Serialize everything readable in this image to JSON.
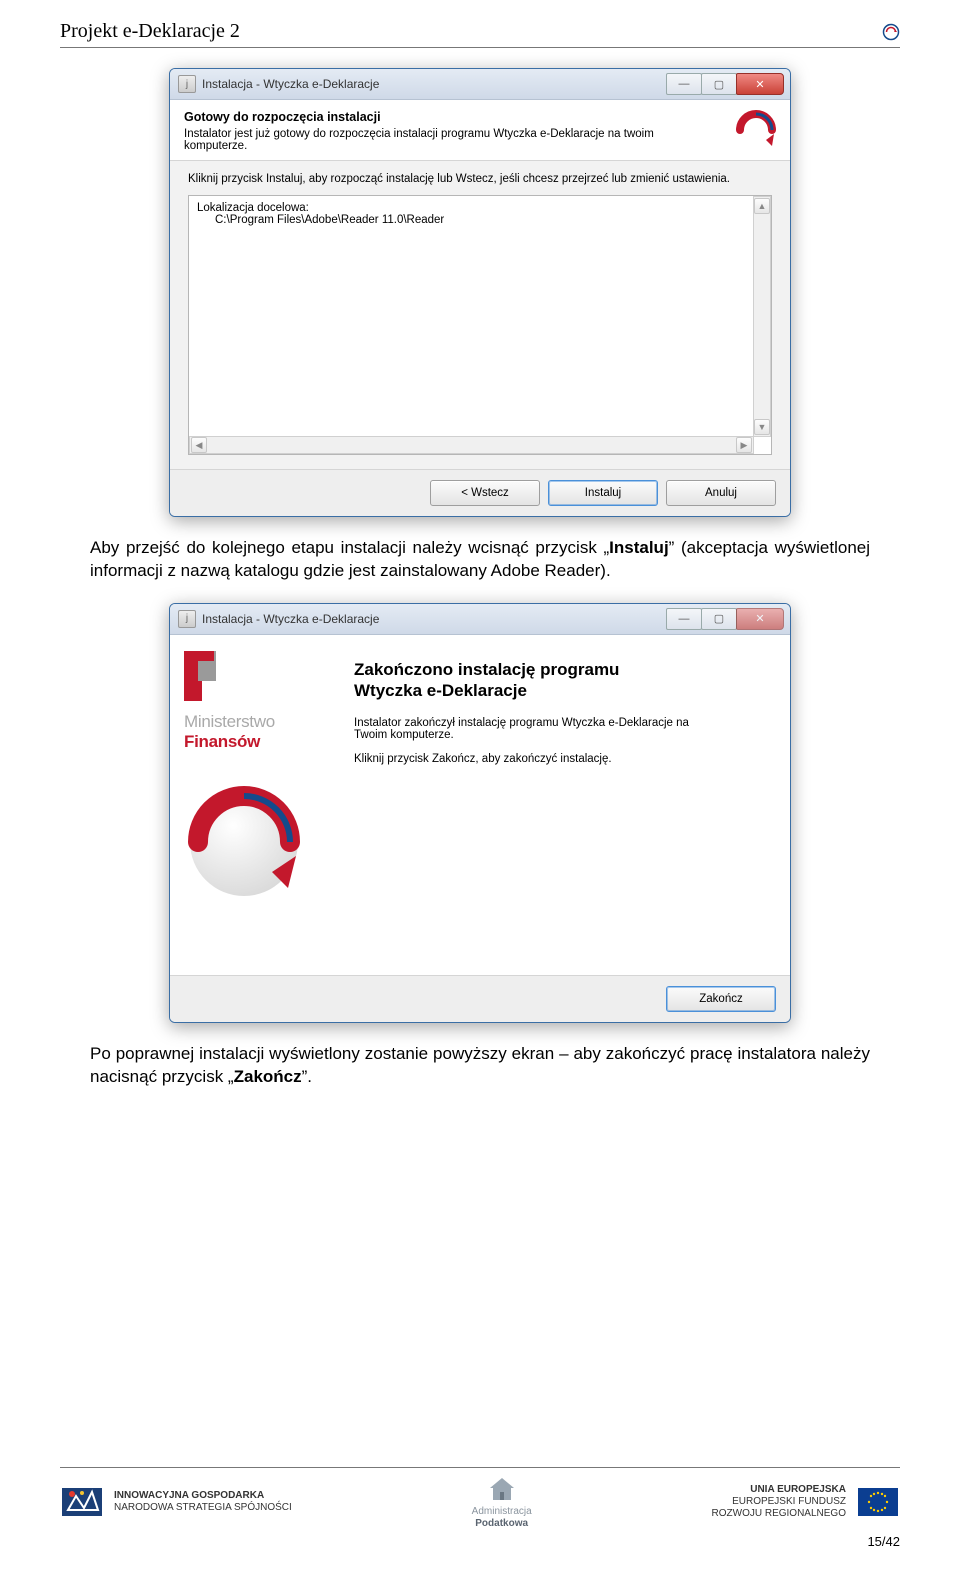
{
  "doc": {
    "header_title": "Projekt e-Deklaracje 2",
    "page_number": "15/42"
  },
  "para1": {
    "prefix": "Aby przejść do kolejnego etapu instalacji należy wcisnąć przycisk „",
    "bold": "Instaluj",
    "suffix": "” (akceptacja wyświetlonej informacji z nazwą katalogu gdzie jest zainstalowany Adobe Reader)."
  },
  "para2": {
    "prefix": "Po poprawnej instalacji wyświetlony zostanie powyższy ekran – aby zakończyć pracę instalatora należy nacisnąć przycisk „",
    "bold": "Zakończ",
    "suffix": "”."
  },
  "win1": {
    "title": "Instalacja - Wtyczka e-Deklaracje",
    "heading": "Gotowy do rozpoczęcia instalacji",
    "subheading": "Instalator jest już gotowy do rozpoczęcia instalacji programu Wtyczka e-Deklaracje na twoim komputerze.",
    "instruction": "Kliknij przycisk Instaluj, aby rozpocząć instalację lub Wstecz, jeśli chcesz przejrzeć lub zmienić ustawienia.",
    "location_label": "Lokalizacja docelowa:",
    "location_path": "C:\\Program Files\\Adobe\\Reader 11.0\\Reader",
    "btn_back": "< Wstecz",
    "btn_install": "Instaluj",
    "btn_cancel": "Anuluj"
  },
  "win2": {
    "title": "Instalacja - Wtyczka e-Deklaracje",
    "heading_line1": "Zakończono instalację programu",
    "heading_line2": "Wtyczka e-Deklaracje",
    "text1": "Instalator zakończył instalację programu Wtyczka e-Deklaracje na Twoim komputerze.",
    "text2": "Kliknij przycisk Zakończ, aby zakończyć instalację.",
    "banner_line1": "Ministerstwo",
    "banner_line2": "Finansów",
    "btn_finish": "Zakończ"
  },
  "footer": {
    "left_line1": "INNOWACYJNA GOSPODARKA",
    "left_line2": "NARODOWA STRATEGIA SPÓJNOŚCI",
    "mid_line1": "Administracja",
    "mid_line2": "Podatkowa",
    "right_line1": "UNIA EUROPEJSKA",
    "right_line2": "EUROPEJSKI FUNDUSZ",
    "right_line3": "ROZWOJU REGIONALNEGO"
  }
}
